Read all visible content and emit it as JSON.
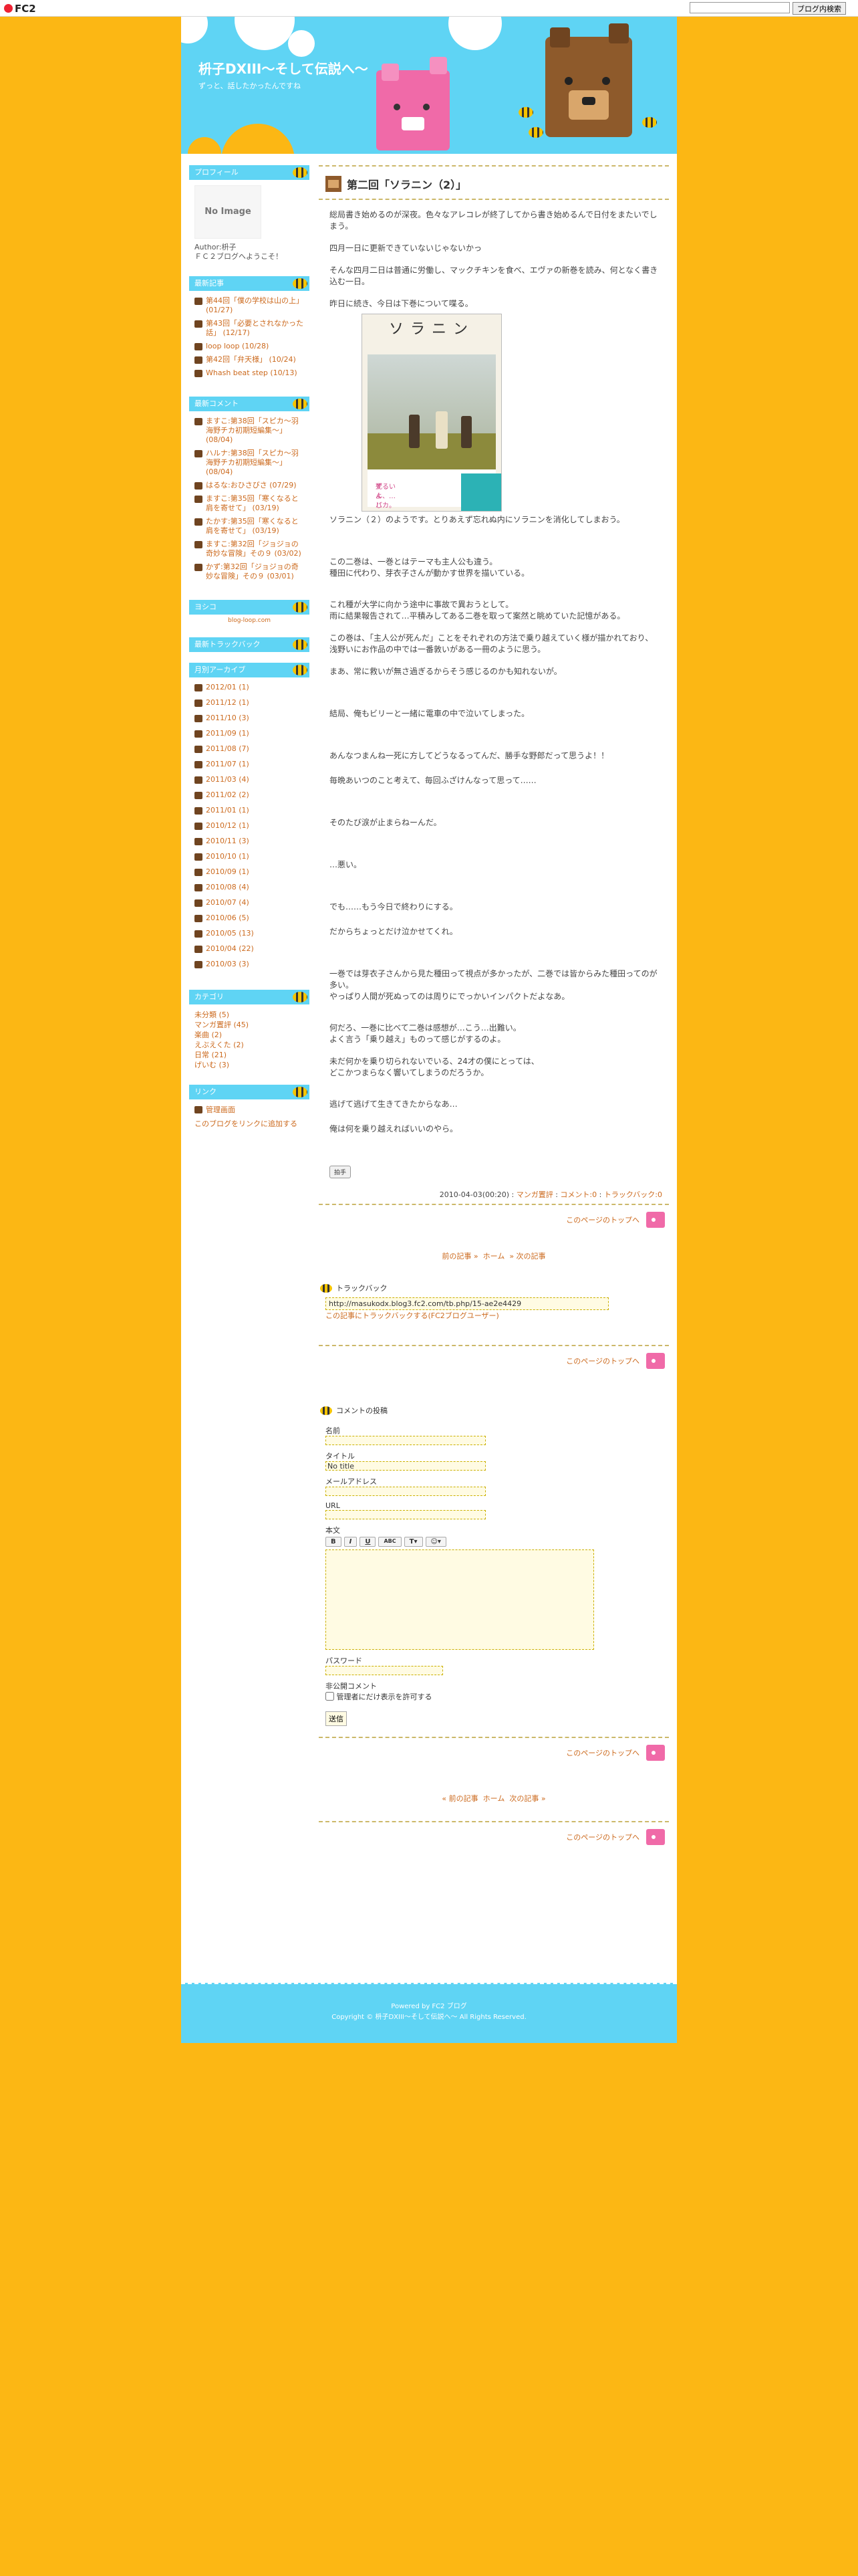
{
  "fc2bar": {
    "logo": "FC2",
    "search_button": "ブログ内検索",
    "search_placeholder": ""
  },
  "site": {
    "title": "枡子DXIII〜そして伝説へ〜",
    "description": "ずっと、話したかったんですね"
  },
  "sidebar": {
    "profile": {
      "heading": "プロフィール",
      "no_image": "No Image",
      "author_label": "Author:枡子",
      "author_note": "ＦＣ２ブログへようこそ！"
    },
    "recent_entries": {
      "heading": "最新記事",
      "items": [
        "第44回「僕の学校は山の上」 (01/27)",
        "第43回「必要とされなかった話」 (12/17)",
        "loop loop (10/28)",
        "第42回「弁天様」 (10/24)",
        "Whash beat step (10/13)"
      ]
    },
    "recent_comments": {
      "heading": "最新コメント",
      "items": [
        "ますこ:第38回「スピカ〜羽海野チカ初期短編集〜」 (08/04)",
        "ハルナ:第38回「スピカ〜羽海野チカ初期短編集〜」 (08/04)",
        "はるな:おひさびさ (07/29)",
        "ますこ:第35回「寒くなると肩を寄せて」 (03/19)",
        "たかす:第35回「寒くなると肩を寄せて」 (03/19)",
        "ますこ:第32回「ジョジョの奇妙な冒険」その９ (03/02)",
        "かず:第32回「ジョジョの奇妙な冒険」その９ (03/01)"
      ]
    },
    "ad": {
      "heading": "ヨシコ",
      "text": "blog-loop.com"
    },
    "trackbacks": {
      "heading": "最新トラックバック"
    },
    "archive": {
      "heading": "月別アーカイブ",
      "items": [
        "2012/01 (1)",
        "2011/12 (1)",
        "2011/10 (3)",
        "2011/09 (1)",
        "2011/08 (7)",
        "2011/07 (1)",
        "2011/03 (4)",
        "2011/02 (2)",
        "2011/01 (1)",
        "2010/12 (1)",
        "2010/11 (3)",
        "2010/10 (1)",
        "2010/09 (1)",
        "2010/08 (4)",
        "2010/07 (4)",
        "2010/06 (5)",
        "2010/05 (13)",
        "2010/04 (22)",
        "2010/03 (3)"
      ]
    },
    "categories": {
      "heading": "カテゴリ",
      "items": [
        "未分類 (5)",
        "マンガ置評 (45)",
        "楽曲 (2)",
        "えぶえくた (2)",
        "日常 (21)",
        "げいむ (3)"
      ]
    },
    "links": {
      "heading": "リンク",
      "items": [
        "管理画面",
        "このブログをリンクに追加する"
      ]
    }
  },
  "entry": {
    "title": "第二回「ソラニン（2）」",
    "paragraphs": [
      "総局書き始めるのが深夜。色々なアレコレが終了してから書き始めるんで日付をまたいでしまう。",
      "四月一日に更新できていないじゃないかっ",
      "そんな四月二日は普通に労働し、マックチキンを食べ、エヴァの新巻を読み、何となく書き込む一日。",
      "昨日に続き、今日は下巻について喋る。"
    ],
    "cover": {
      "title": "ソラニン",
      "caption_line1": "死んじゃうなんて、",
      "caption_line2": "ずるいよ、…バカ。"
    },
    "paragraphs2": [
      "ソラニン（２）のようです。とりあえず忘れぬ内にソラニンを消化してしまおう。",
      "この二巻は、一巻とはテーマも主人公も違う。\n種田に代わり、芽衣子さんが動かす世界を描いている。",
      "これ種が大学に向かう途中に事故で異おうとして。\n雨に結果報告されて…平積みしてある二巻を取って案然と眺めていた記憶がある。",
      "この巻は、「主人公が死んだ」ことをそれぞれの方法で乗り越えていく様が描かれており、\n浅野いにお作品の中では一番敦いがある一冊のように思う。",
      "まあ、常に救いが無さ過ぎるからそう感じるのかも知れないが。",
      "結局、俺もビリーと一緒に電車の中で泣いてしまった。",
      "あんなつまんね一死に方してどうなるってんだ、勝手な野郎だって思うよ！！",
      "毎晩あいつのこと考えて、毎回ふざけんなって思って……",
      "そのたび涙が止まらねーんだ。",
      "…悪い。",
      "でも……もう今日で終わりにする。",
      "だからちょっとだけ泣かせてくれ。",
      "一巻では芽衣子さんから見た種田って視点が多かったが、二巻では皆からみた種田ってのが多い。\nやっぱり人間が死ぬってのは周りにでっかいインパクトだよなあ。",
      "何だろ、一巻に比べて二巻は感想が…こう…出難い。\nよく言う「乗り越え」ものって感じがするのよ。",
      "未だ何かを乗り切られないでいる、24才の僕にとっては、\nどこかつまらなく響いてしまうのだろうか。",
      "逃げて逃げて生きてきたからなあ…",
      "俺は何を乗り越えればいいのやら。"
    ],
    "clap": "拍手",
    "meta": {
      "date": "2010-04-03(00:20)",
      "category": "マンガ置評",
      "comments": "コメント:0",
      "trackbacks": "トラックバック:0"
    },
    "to_top": "このページのトップへ"
  },
  "pager": {
    "prev": "前の記事 »",
    "home": "ホーム",
    "next": "» 次の記事"
  },
  "trackback": {
    "heading": "トラックバック",
    "url": "http://masukodx.blog3.fc2.com/tb.php/15-ae2e4429",
    "link": "この記事にトラックバックする(FC2ブログユーザー)"
  },
  "comment_form": {
    "heading": "コメントの投稿",
    "name_label": "名前",
    "title_label": "タイトル",
    "title_value": "No title",
    "email_label": "メールアドレス",
    "url_label": "URL",
    "body_label": "本文",
    "tools": [
      "B",
      "I",
      "U",
      "ABC",
      "T▾",
      "☺▾"
    ],
    "password_label": "パスワード",
    "private_label": "非公開コメント",
    "private_option": "管理者にだけ表示を許可する",
    "submit": "送信"
  },
  "pager2": {
    "prev": "« 前の記事",
    "home": "ホーム",
    "next": "次の記事 »"
  },
  "footer": {
    "powered": "Powered by FC2 ブログ",
    "copyright": "Copyright © 枡子DXIII〜そして伝説へ〜 All Rights Reserved."
  }
}
